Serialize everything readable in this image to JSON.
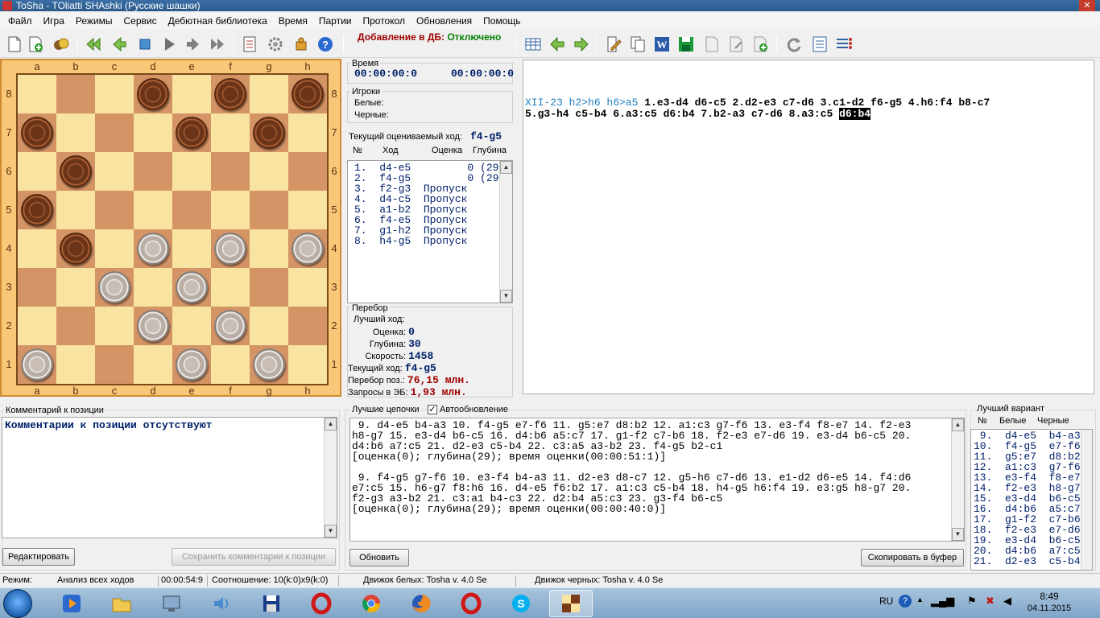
{
  "window": {
    "title": "ToSha - TOliatti SHAshki (Русские шашки)"
  },
  "menu": [
    "Файл",
    "Игра",
    "Режимы",
    "Сервис",
    "Дебютная библиотека",
    "Время",
    "Партии",
    "Протокол",
    "Обновления",
    "Помощь"
  ],
  "toolbar": {
    "db_label": "Добавление в ДБ:",
    "db_value": "Отключено"
  },
  "board": {
    "files": [
      "a",
      "b",
      "c",
      "d",
      "e",
      "f",
      "g",
      "h"
    ],
    "ranks": [
      "8",
      "7",
      "6",
      "5",
      "4",
      "3",
      "2",
      "1"
    ],
    "pieces": {
      "d8": "b",
      "f8": "b",
      "h8": "b",
      "a7": "b",
      "e7": "b",
      "g7": "b",
      "b6": "b",
      "a5": "b",
      "b4": "b",
      "d4": "w",
      "f4": "w",
      "h4": "w",
      "c3": "w",
      "e3": "w",
      "d2": "w",
      "f2": "w",
      "a1": "w",
      "e1": "w",
      "g1": "w"
    }
  },
  "time_panel": {
    "label": "Время",
    "white": "00:00:00:0",
    "black": "00:00:00:0"
  },
  "players_panel": {
    "label": "Игроки",
    "white_label": "Белые:",
    "black_label": "Черные:"
  },
  "current_move": {
    "label": "Текущий оцениваемый ход:",
    "value": "f4-g5",
    "col_num": "№",
    "col_move": "Ход",
    "col_eval": "Оценка",
    "col_depth": "Глубина"
  },
  "moves": [
    "1.  d4-e5         0 (29)",
    "2.  f4-g5         0 (29)",
    "3.  f2-g3  Пропуск",
    "4.  d4-c5  Пропуск",
    "5.  a1-b2  Пропуск",
    "6.  f4-e5  Пропуск",
    "7.  g1-h2  Пропуск",
    "8.  h4-g5  Пропуск"
  ],
  "enumeration": {
    "label": "Перебор",
    "best_label": "Лучший ход:",
    "eval_label": "Оценка:",
    "eval_value": "0",
    "depth_label": "Глубина:",
    "depth_value": "30",
    "speed_label": "Скорость:",
    "speed_value": "1458",
    "cur_label": "Текущий ход:",
    "cur_value": "f4-g5",
    "pos_label": "Перебор поз.:",
    "pos_value": "76,15 млн.",
    "eb_label": "Запросы в ЭБ:",
    "eb_value": "1,93 млн."
  },
  "notation": {
    "header": "XII-23 h2>h6 h6>a5",
    "line1": "1.e3-d4 d6-c5 2.d2-e3 c7-d6 3.c1-d2 f6-g5 4.h6:f4 b8-c7",
    "line2": "5.g3-h4 c5-b4 6.a3:c5 d6:b4 7.b2-a3 c7-d6 8.a3:c5",
    "selected": "d6:b4"
  },
  "comment_panel": {
    "label": "Комментарий к позиции",
    "text": "Комментарии к позиции отсутствуют",
    "edit_button": "Редактировать",
    "save_button": "Сохранить комментарии к позиции"
  },
  "chains_panel": {
    "label": "Лучшие цепочки",
    "auto_label": "Автообновление",
    "lines": [
      " 9. d4-e5 b4-a3 10. f4-g5 e7-f6 11. g5:e7 d8:b2 12. a1:c3 g7-f6 13. e3-f4 f8-e7 14. f2-e3",
      "h8-g7 15. e3-d4 b6-c5 16. d4:b6 a5:c7 17. g1-f2 c7-b6 18. f2-e3 e7-d6 19. e3-d4 b6-c5 20.",
      "d4:b6 a7:c5 21. d2-e3 c5-b4 22. c3:a5 a3-b2 23. f4-g5 b2-c1",
      "[оценка(0); глубина(29); время оценки(00:00:51:1)]",
      "",
      " 9. f4-g5 g7-f6 10. e3-f4 b4-a3 11. d2-e3 d8-c7 12. g5-h6 c7-d6 13. e1-d2 d6-e5 14. f4:d6",
      "e7:c5 15. h6-g7 f8:h6 16. d4-e5 f6:b2 17. a1:c3 c5-b4 18. h4-g5 h6:f4 19. e3:g5 h8-g7 20.",
      "f2-g3 a3-b2 21. c3:a1 b4-c3 22. d2:b4 a5:c3 23. g3-f4 b6-c5",
      "[оценка(0); глубина(29); время оценки(00:00:40:0)]"
    ],
    "refresh_button": "Обновить",
    "copy_button": "Скопировать в буфер"
  },
  "best_variant": {
    "label": "Лучший вариант",
    "col_num": "№",
    "col_white": "Белые",
    "col_black": "Черные",
    "rows": [
      " 9.  d4-e5  b4-a3",
      "10.  f4-g5  e7-f6",
      "11.  g5:e7  d8:b2",
      "12.  a1:c3  g7-f6",
      "13.  e3-f4  f8-e7",
      "14.  f2-e3  h8-g7",
      "15.  e3-d4  b6-c5",
      "16.  d4:b6  a5:c7",
      "17.  g1-f2  c7-b6",
      "18.  f2-e3  e7-d6",
      "19.  e3-d4  b6-c5",
      "20.  d4:b6  a7:c5",
      "21.  d2-e3  c5-b4"
    ]
  },
  "status": {
    "mode_label": "Режим:",
    "mode_value": "Анализ всех ходов",
    "time": "00:00:54:9",
    "ratio": "Соотношение: 10(k:0)x9(k:0)",
    "white_engine": "Движок белых: Tosha v. 4.0 Se",
    "black_engine": "Движок черных: Tosha v. 4.0 Se"
  },
  "tray": {
    "lang": "RU",
    "time": "8:49",
    "date": "04.11.2015"
  },
  "colors": {
    "light_square": "#f8e4a0",
    "dark_square": "#d49466",
    "text_blue": "#00206a",
    "text_red": "#a00000"
  }
}
